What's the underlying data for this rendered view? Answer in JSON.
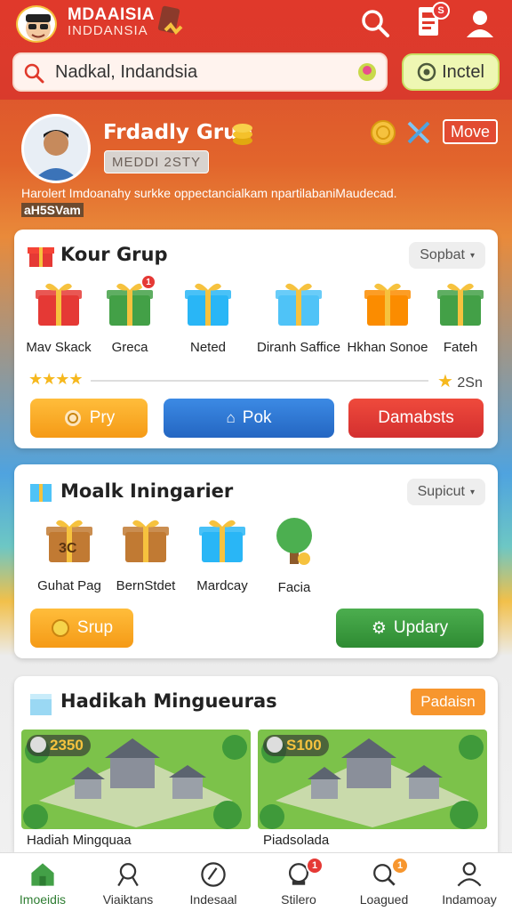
{
  "header": {
    "brand_line1": "MDAAISIA",
    "brand_line2": "INDDANSIA",
    "badge_count": "S",
    "search_placeholder": "Nadkal, Indandsia",
    "action_button": "Inctel"
  },
  "hero": {
    "name": "Frdadly Grup",
    "tag": "MEDDI 2STY",
    "description": "Harolert Imdoanahy surkke oppectancialkam npartilabaniMaudecad.",
    "subline": "aH5SVam",
    "move_button": "Move"
  },
  "card1": {
    "title": "Kour Grup",
    "select": "Sopbat",
    "items": [
      {
        "label": "Mav Skack",
        "color": "#e53935"
      },
      {
        "label": "Greca",
        "color": "#43a047",
        "badge": "1"
      },
      {
        "label": "Neted",
        "color": "#29b6f6"
      },
      {
        "label": "Diranh Saffice",
        "color": "#4fc3f7"
      },
      {
        "label": "Hkhan Sonoe",
        "color": "#fb8c00"
      },
      {
        "label": "Fateh",
        "color": "#43a047"
      }
    ],
    "stars": "★★★★",
    "right_value": "2Sn",
    "buttons": {
      "play": "Pry",
      "pok": "Pok",
      "danger": "Damabsts"
    }
  },
  "card2": {
    "title": "Moalk Iningarier",
    "select": "Supicut",
    "items": [
      {
        "label": "Guhat Pag",
        "color": "#c17a33",
        "overlay": "3C"
      },
      {
        "label": "BernStdet",
        "color": "#c17a33"
      },
      {
        "label": "Mardcay",
        "color": "#29b6f6"
      },
      {
        "label": "Facia",
        "color": "#4caf50"
      }
    ],
    "buttons": {
      "srup": "Srup",
      "update": "Updary"
    }
  },
  "card3": {
    "title": "Hadikah Mingueuras",
    "button": "Padaisn",
    "tiles": [
      {
        "price": "2350",
        "caption": "Hadiah Mingquaa"
      },
      {
        "price": "S100",
        "caption": "Piadsolada"
      }
    ]
  },
  "nav": {
    "items": [
      {
        "label": "Imoeidis",
        "active": true
      },
      {
        "label": "Viaiktans"
      },
      {
        "label": "Indesaal"
      },
      {
        "label": "Stilero",
        "badge": "1"
      },
      {
        "label": "Loagued",
        "badge": "1"
      },
      {
        "label": "Indamoay"
      }
    ]
  },
  "colors": {
    "primary": "#e0392b",
    "accent": "#f6a623",
    "blue": "#2f78d4",
    "green": "#43a047",
    "danger": "#e53935"
  }
}
